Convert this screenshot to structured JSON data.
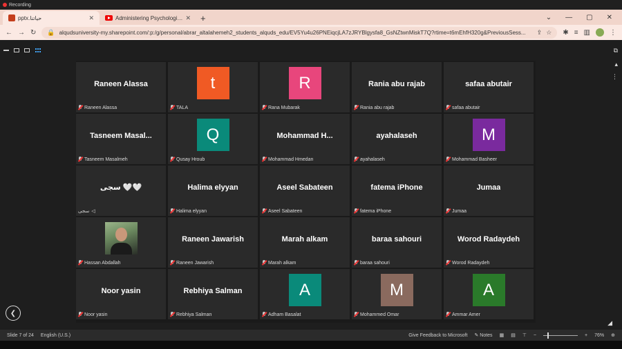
{
  "recording": {
    "label": "Recording"
  },
  "tabs": [
    {
      "title": "pptx.حياتنا",
      "active": true,
      "icon": "powerpoint-icon"
    },
    {
      "title": "Administering Psychological Fir",
      "active": false,
      "icon": "youtube-icon"
    }
  ],
  "browser": {
    "url": "alqudsuniversity-my.sharepoint.com/:p:/g/personal/abrar_altalahemeh2_students_alquds_edu/EV5Yu4u26PNEiqcjLA7zJRYBlgysfa8_GsNZtwnMiskT7Q?rtime=t6mEhfH320g&PreviousSess..."
  },
  "participants": [
    {
      "name": "Raneen Alassa",
      "label": "Raneen Alassa",
      "type": "name",
      "muted": true
    },
    {
      "name": "",
      "label": "TALA",
      "type": "initial",
      "initial": "t",
      "color": "#f05a24",
      "muted": true
    },
    {
      "name": "",
      "label": "Rana Mubarak",
      "type": "initial",
      "initial": "R",
      "color": "#e8467c",
      "muted": true
    },
    {
      "name": "Rania abu rajab",
      "label": "Rania abu rajab",
      "type": "name",
      "muted": true
    },
    {
      "name": "safaa abutair",
      "label": "safaa abutair",
      "type": "name",
      "muted": true
    },
    {
      "name": "Tasneem  Masal...",
      "label": "Tasneem Masalmeh",
      "type": "name",
      "muted": true
    },
    {
      "name": "",
      "label": "Qusay Hroub",
      "type": "initial",
      "initial": "Q",
      "color": "#0a8a7a",
      "muted": true
    },
    {
      "name": "Mohammad  H...",
      "label": "Mohammad Hmedan",
      "type": "name",
      "muted": true
    },
    {
      "name": "ayahalaseh",
      "label": "ayahalaseh",
      "type": "name",
      "muted": true
    },
    {
      "name": "",
      "label": "Mohammad Basheer",
      "type": "initial",
      "initial": "M",
      "color": "#7a2a9e",
      "muted": true
    },
    {
      "name": "سجى 🤍🤍",
      "label": "سجى",
      "type": "name",
      "muted": false
    },
    {
      "name": "Halima elyyan",
      "label": "Halima elyyan",
      "type": "name",
      "muted": true
    },
    {
      "name": "Aseel Sabateen",
      "label": "Aseel Sabateen",
      "type": "name",
      "muted": true
    },
    {
      "name": "fatema iPhone",
      "label": "fatema iPhone",
      "type": "name",
      "muted": true
    },
    {
      "name": "Jumaa",
      "label": "Jumaa",
      "type": "name",
      "muted": true
    },
    {
      "name": "",
      "label": "Hassan Abdallah",
      "type": "photo",
      "muted": true
    },
    {
      "name": "Raneen Jawarish",
      "label": "Raneen Jawarish",
      "type": "name",
      "muted": true
    },
    {
      "name": "Marah alkam",
      "label": "Marah alkam",
      "type": "name",
      "muted": true
    },
    {
      "name": "baraa sahouri",
      "label": "baraa sahouri",
      "type": "name",
      "muted": true
    },
    {
      "name": "Worod Radaydeh",
      "label": "Worod Radaydeh",
      "type": "name",
      "muted": true
    },
    {
      "name": "Noor yasin",
      "label": "Noor yasin",
      "type": "name",
      "muted": true
    },
    {
      "name": "Rebhiya Salman",
      "label": "Rebhiya Salman",
      "type": "name",
      "muted": true
    },
    {
      "name": "",
      "label": "Adham Basalat",
      "type": "initial",
      "initial": "A",
      "color": "#0a8a7a",
      "muted": true
    },
    {
      "name": "",
      "label": "Mohammed Omar",
      "type": "initial",
      "initial": "M",
      "color": "#8a6a5e",
      "muted": true
    },
    {
      "name": "",
      "label": "Ammar Amer",
      "type": "initial",
      "initial": "A",
      "color": "#2a7a2a",
      "muted": true
    }
  ],
  "status": {
    "slide": "Slide 7 of 24",
    "language": "English (U.S.)",
    "feedback": "Give Feedback to Microsoft",
    "notes": "Notes",
    "zoom": "76%"
  }
}
